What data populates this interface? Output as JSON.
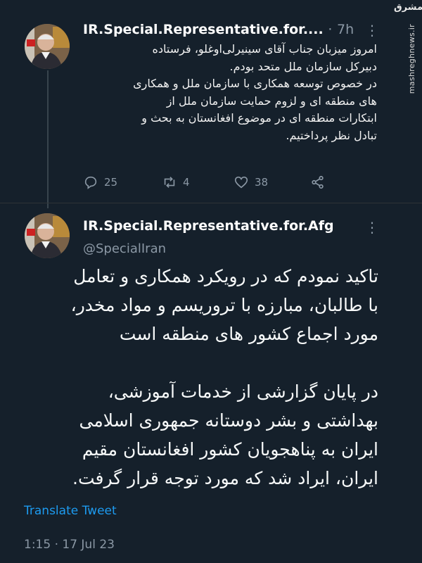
{
  "watermark": {
    "logo": "مشرق",
    "site": "mashreghnews.ir"
  },
  "tweet1": {
    "display_name": "IR.Special.Representative.for....",
    "separator": "·",
    "time": "7h",
    "text": "امروز میزبان جناب آقای سینیرلی‌اوغلو، فرستاده\nدبیرکل سازمان ملل متحد بودم.\nدر خصوص توسعه همکاری با سازمان ملل و همکاری\nهای منطقه ای و لزوم حمایت سازمان ملل از\nابتکارات منطقه ای در موضوع افغانستان به بحث و\nتبادل نظر پرداختیم.",
    "replies": "25",
    "retweets": "4",
    "likes": "38",
    "icons": [
      "reply-icon",
      "retweet-icon",
      "like-icon",
      "share-icon"
    ]
  },
  "tweet2": {
    "display_name": "IR.Special.Representative.for.Afg",
    "handle": "@SpecialIran",
    "text": "تاکید نمودم که در رویکرد همکاری و تعامل\nبا طالبان، مبارزه با تروریسم و مواد مخدر،\nمورد اجماع کشور های منطقه است\n\nدر پایان گزارشی از خدمات آموزشی،\nبهداشتی و بشر دوستانه جمهوری اسلامی\nایران به پناهجویان کشور افغانستان مقیم\nایران، ایراد شد که مورد توجه قرار گرفت.",
    "translate_label": "Translate Tweet",
    "timestamp": "1:15 · 17 Jul 23"
  },
  "colors": {
    "background": "#15202b",
    "muted": "#8b98a5",
    "link": "#1d9bf0"
  }
}
